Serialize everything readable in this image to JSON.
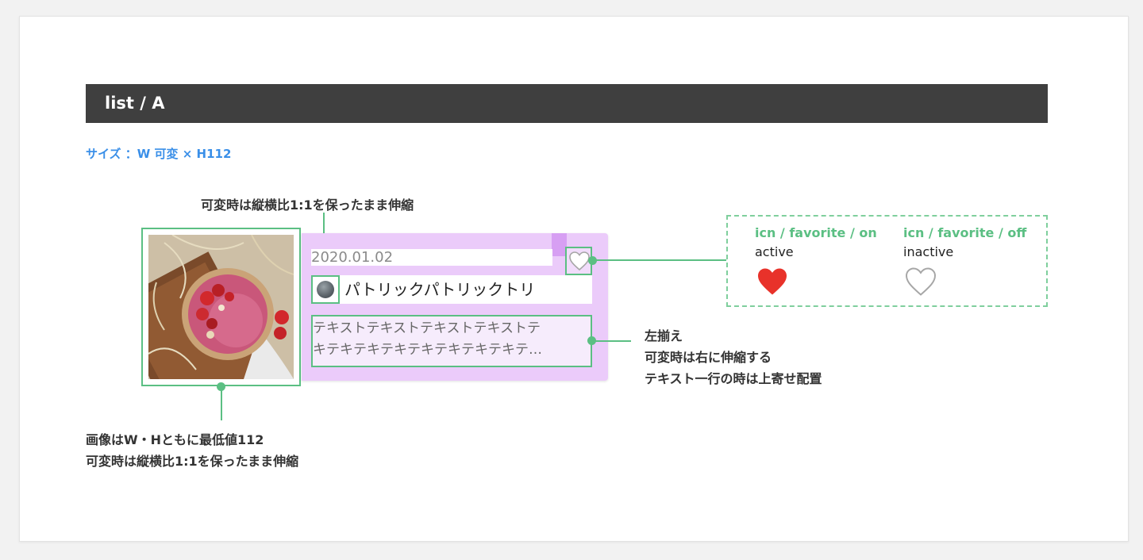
{
  "header": {
    "title": "list / A"
  },
  "size_label": "サイズ ：W 可変 × H112",
  "notes": {
    "avatar": "可変時は縦横比1:1を保ったまま伸縮",
    "image_line1": "画像はW・Hともに最低値112",
    "image_line2": "可変時は縦横比1:1を保ったまま伸縮",
    "text_line1": "左揃え",
    "text_line2": "可変時は右に伸縮する",
    "text_line3": "テキスト一行の時は上寄せ配置"
  },
  "card": {
    "date": "2020.01.02",
    "user_name": "パトリックパトリックトリ",
    "desc_line1": "テキストテキストテキストテキストテ",
    "desc_line2": "キテキテキテキテキテキテキテキテ…"
  },
  "legend": {
    "on_title": "icn / favorite / on",
    "on_state": "active",
    "off_title": "icn / favorite / off",
    "off_state": "inactive"
  },
  "colors": {
    "accent_green": "#5bbf83",
    "card_bg": "#ebcbfa",
    "header_bg": "#3f3f3f",
    "size_blue": "#3a8fe8",
    "heart_red": "#e8322a"
  },
  "icons": {
    "favorite_on": "heart-filled-icon",
    "favorite_off": "heart-outline-icon",
    "avatar": "avatar-icon"
  }
}
